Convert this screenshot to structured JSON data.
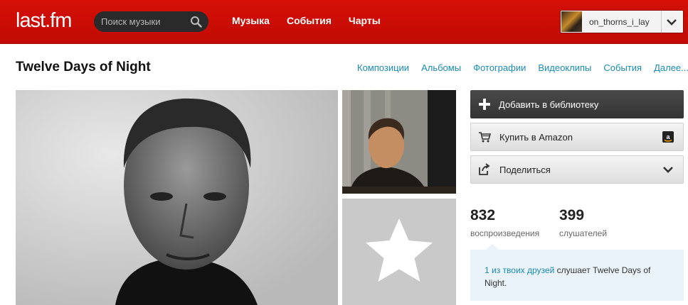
{
  "header": {
    "logo": "last.fm",
    "search_placeholder": "Поиск музыки",
    "nav": [
      "Музыка",
      "События",
      "Чарты"
    ],
    "username": "on_thorns_i_lay",
    "brand_color": "#d51007"
  },
  "artist": {
    "name": "Twelve Days of Night",
    "tabs": [
      "Композиции",
      "Альбомы",
      "Фотографии",
      "Видеоклипы",
      "События",
      "Далее..."
    ]
  },
  "actions": {
    "add_library": "Добавить в библиотеку",
    "buy_amazon": "Купить в Amazon",
    "share": "Поделиться"
  },
  "stats": {
    "plays": "832",
    "plays_label": "воспроизведения",
    "listeners": "399",
    "listeners_label": "слушателей"
  },
  "friends": {
    "link": "1 из твоих друзей",
    "text": " слушает Twelve Days of Night."
  }
}
